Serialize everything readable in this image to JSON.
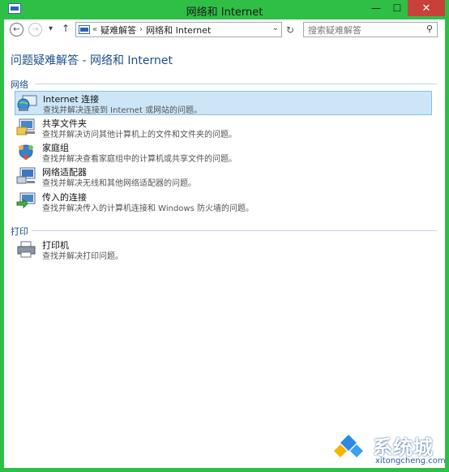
{
  "window": {
    "title": "网络和 Internet",
    "close_glyph": "✕",
    "minimize_glyph": "—",
    "maximize_glyph": "☐"
  },
  "nav": {
    "back_glyph": "←",
    "forward_glyph": "→",
    "recent_glyph": "▾",
    "up_glyph": "↑",
    "address": {
      "overflow": "«",
      "crumbs": [
        "疑难解答",
        "网络和 Internet"
      ],
      "separator": "›",
      "dropdown_glyph": "⌄"
    },
    "refresh_glyph": "↻",
    "search": {
      "placeholder": "搜索疑难解答",
      "icon": "search-icon",
      "glyph": "⚲"
    }
  },
  "page": {
    "title": "问题疑难解答 - 网络和 Internet"
  },
  "sections": [
    {
      "label": "网络",
      "items": [
        {
          "title": "Internet 连接",
          "desc": "查找并解决连接到 Internet 或网站的问题。",
          "icon": "internet-connection-icon",
          "selected": true
        },
        {
          "title": "共享文件夹",
          "desc": "查找并解决访问其他计算机上的文件和文件夹的问题。",
          "icon": "shared-folders-icon",
          "selected": false
        },
        {
          "title": "家庭组",
          "desc": "查找并解决查看家庭组中的计算机或共享文件的问题。",
          "icon": "homegroup-icon",
          "selected": false
        },
        {
          "title": "网络适配器",
          "desc": "查找并解决无线和其他网络适配器的问题。",
          "icon": "network-adapter-icon",
          "selected": false
        },
        {
          "title": "传入的连接",
          "desc": "查找并解决传入的计算机连接和 Windows 防火墙的问题。",
          "icon": "incoming-connections-icon",
          "selected": false
        }
      ]
    },
    {
      "label": "打印",
      "items": [
        {
          "title": "打印机",
          "desc": "查找并解决打印问题。",
          "icon": "printer-icon",
          "selected": false
        }
      ]
    }
  ],
  "watermark": {
    "text": "系统城",
    "url": "xitongcheng.com"
  },
  "colors": {
    "accent": "#1e4e8c",
    "selection": "#cde6f7",
    "frame": "#2fbf46",
    "close": "#c7403a"
  }
}
